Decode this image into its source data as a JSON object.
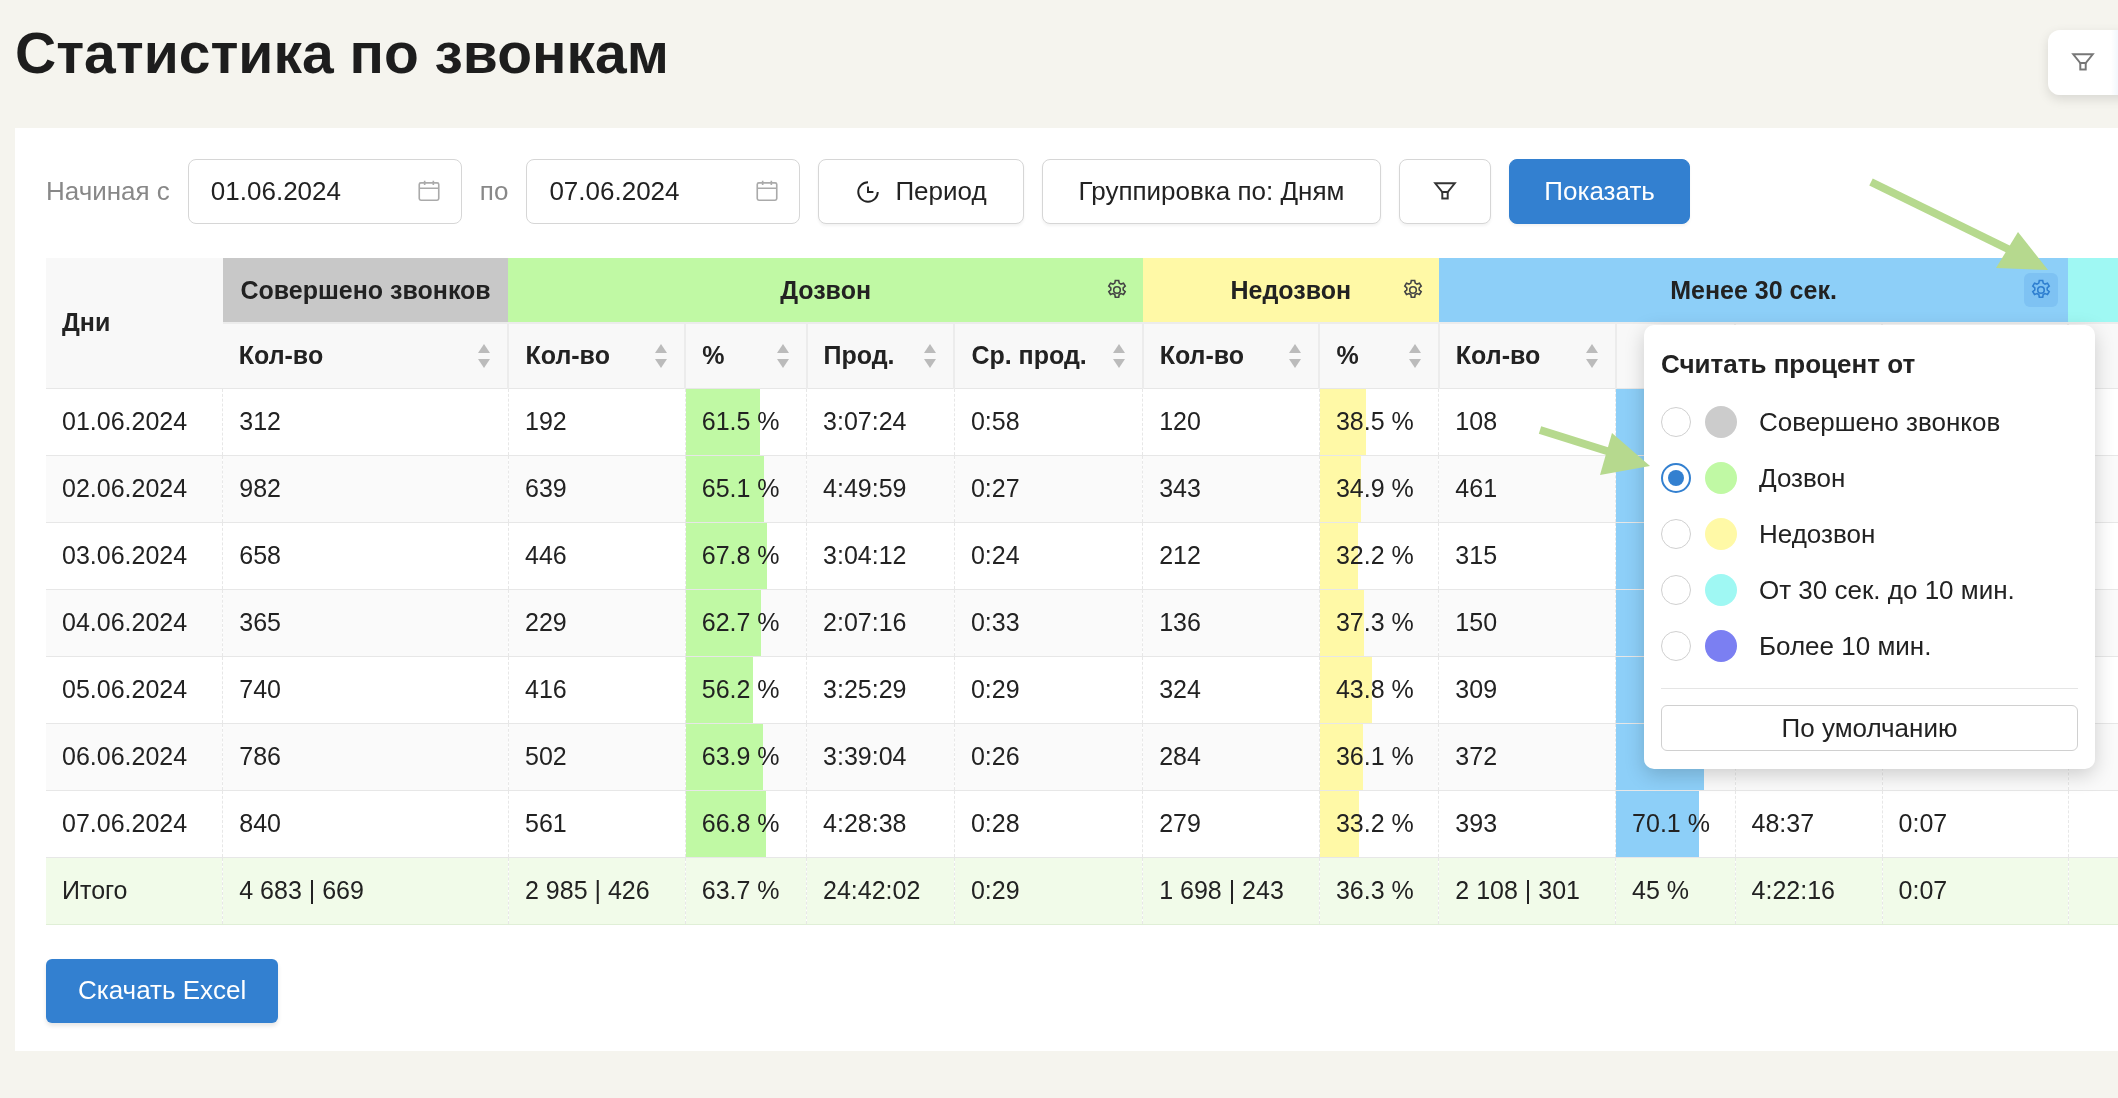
{
  "title": "Статистика по звонкам",
  "toolbar": {
    "from_label": "Начиная с",
    "from_date": "01.06.2024",
    "to_label": "по",
    "to_date": "07.06.2024",
    "period_button": "Период",
    "grouping_button": "Группировка по: Дням",
    "show_button": "Показать"
  },
  "table": {
    "days_header": "Дни",
    "groups": [
      {
        "label": "Совершено звонков",
        "color": "#c8c8c8",
        "gear": false,
        "columns": [
          "Кол-во"
        ]
      },
      {
        "label": "Дозвон",
        "color": "#c0f9a4",
        "gear": true,
        "gear_active": false,
        "columns": [
          "Кол-во",
          "%",
          "Прод.",
          "Ср. прод."
        ]
      },
      {
        "label": "Недозвон",
        "color": "#fff9a6",
        "gear": true,
        "gear_active": false,
        "columns": [
          "Кол-во",
          "%"
        ]
      },
      {
        "label": "Менее 30 сек.",
        "color": "#8dcff8",
        "gear": true,
        "gear_active": true,
        "columns": [
          "Кол-во"
        ]
      },
      {
        "color": "#9ff8f3"
      }
    ],
    "rows": [
      {
        "day": "01.06.2024",
        "cells": [
          {
            "text": "312"
          },
          {
            "text": "192"
          },
          {
            "text": "61.5 %",
            "level": 0.615
          },
          {
            "text": "3:07:24"
          },
          {
            "text": "0:58"
          },
          {
            "text": "120"
          },
          {
            "text": "38.5 %",
            "level": 0.385
          },
          {
            "text": "108"
          },
          {
            "level": 0.563
          },
          {},
          {}
        ]
      },
      {
        "day": "02.06.2024",
        "cells": [
          {
            "text": "982"
          },
          {
            "text": "639"
          },
          {
            "text": "65.1 %",
            "level": 0.651
          },
          {
            "text": "4:49:59"
          },
          {
            "text": "0:27"
          },
          {
            "text": "343"
          },
          {
            "text": "34.9 %",
            "level": 0.349
          },
          {
            "text": "461"
          },
          {
            "level": 0.721
          },
          {},
          {}
        ]
      },
      {
        "day": "03.06.2024",
        "cells": [
          {
            "text": "658"
          },
          {
            "text": "446"
          },
          {
            "text": "67.8 %",
            "level": 0.678
          },
          {
            "text": "3:04:12"
          },
          {
            "text": "0:24"
          },
          {
            "text": "212"
          },
          {
            "text": "32.2 %",
            "level": 0.322
          },
          {
            "text": "315"
          },
          {
            "level": 0.706
          },
          {},
          {}
        ]
      },
      {
        "day": "04.06.2024",
        "cells": [
          {
            "text": "365"
          },
          {
            "text": "229"
          },
          {
            "text": "62.7 %",
            "level": 0.627
          },
          {
            "text": "2:07:16"
          },
          {
            "text": "0:33"
          },
          {
            "text": "136"
          },
          {
            "text": "37.3 %",
            "level": 0.373
          },
          {
            "text": "150"
          },
          {
            "level": 0.655
          },
          {},
          {}
        ]
      },
      {
        "day": "05.06.2024",
        "cells": [
          {
            "text": "740"
          },
          {
            "text": "416"
          },
          {
            "text": "56.2 %",
            "level": 0.562
          },
          {
            "text": "3:25:29"
          },
          {
            "text": "0:29"
          },
          {
            "text": "324"
          },
          {
            "text": "43.8 %",
            "level": 0.438
          },
          {
            "text": "309"
          },
          {
            "level": 0.743
          },
          {},
          {}
        ]
      },
      {
        "day": "06.06.2024",
        "cells": [
          {
            "text": "786"
          },
          {
            "text": "502"
          },
          {
            "text": "63.9 %",
            "level": 0.639
          },
          {
            "text": "3:39:04"
          },
          {
            "text": "0:26"
          },
          {
            "text": "284"
          },
          {
            "text": "36.1 %",
            "level": 0.361
          },
          {
            "text": "372"
          },
          {
            "level": 0.741
          },
          {},
          {}
        ]
      },
      {
        "day": "07.06.2024",
        "cells": [
          {
            "text": "840"
          },
          {
            "text": "561"
          },
          {
            "text": "66.8 %",
            "level": 0.668
          },
          {
            "text": "4:28:38"
          },
          {
            "text": "0:28"
          },
          {
            "text": "279"
          },
          {
            "text": "33.2 %",
            "level": 0.332
          },
          {
            "text": "393"
          },
          {
            "text": "70.1 %",
            "level": 0.701
          },
          {
            "text": "48:37"
          },
          {
            "text": "0:07"
          }
        ]
      }
    ],
    "total": {
      "label": "Итого",
      "cells": [
        "4 683 | 669",
        "2 985 | 426",
        "63.7 %",
        "24:42:02",
        "0:29",
        "1 698 | 243",
        "36.3 %",
        "2 108 | 301",
        "45 %",
        "4:22:16",
        "0:07"
      ]
    }
  },
  "popup": {
    "title": "Считать процент от",
    "options": [
      {
        "label": "Совершено звонков",
        "color": "#cccccc",
        "selected": false
      },
      {
        "label": "Дозвон",
        "color": "#c0f9a4",
        "selected": true
      },
      {
        "label": "Недозвон",
        "color": "#fff9a6",
        "selected": false
      },
      {
        "label": "От 30 сек. до 10 мин.",
        "color": "#9ff8f3",
        "selected": false
      },
      {
        "label": "Более 10 мин.",
        "color": "#7b7ff2",
        "selected": false
      }
    ],
    "default_button": "По умолчанию"
  },
  "download_button": "Скачать Excel"
}
